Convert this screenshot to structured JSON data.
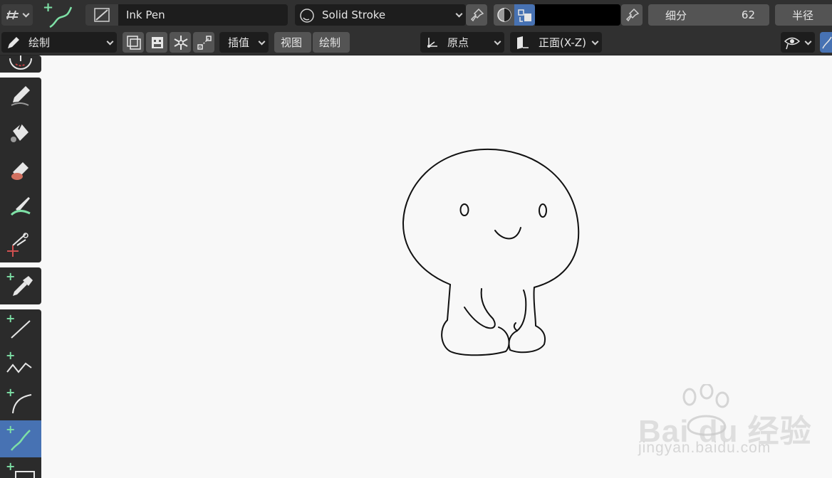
{
  "header": {
    "brush_name": "Ink Pen",
    "material_name": "Solid Stroke",
    "color_hex": "#000000",
    "subdivide_label": "细分",
    "subdivide_value": "62",
    "radius_label": "半径"
  },
  "toolbar2": {
    "mode_label": "绘制",
    "interpolate_label": "插值",
    "view_label": "视图",
    "draw_label": "绘制",
    "origin_label": "原点",
    "plane_label": "正面(X-Z)"
  },
  "tools": [
    {
      "name": "draw",
      "icon": "pencil-icon"
    },
    {
      "name": "fill",
      "icon": "paint-bucket-icon"
    },
    {
      "name": "erase",
      "icon": "eraser-icon"
    },
    {
      "name": "tint",
      "icon": "brush-icon"
    },
    {
      "name": "cutter",
      "icon": "scissors-icon"
    },
    {
      "name": "eyedropper",
      "icon": "eyedropper-icon"
    },
    {
      "name": "line",
      "icon": "line-icon"
    },
    {
      "name": "polyline",
      "icon": "polyline-icon"
    },
    {
      "name": "arc",
      "icon": "arc-icon"
    },
    {
      "name": "curve",
      "icon": "curve-icon",
      "active": true
    },
    {
      "name": "box",
      "icon": "box-icon"
    }
  ],
  "watermark": {
    "brand": "Bai du 经验",
    "url": "jingyan.baidu.com"
  },
  "colors": {
    "accent": "#4772b3",
    "header_bg": "#303030",
    "canvas_bg": "#f8f8f8",
    "green_plus": "#7ee0a6"
  }
}
